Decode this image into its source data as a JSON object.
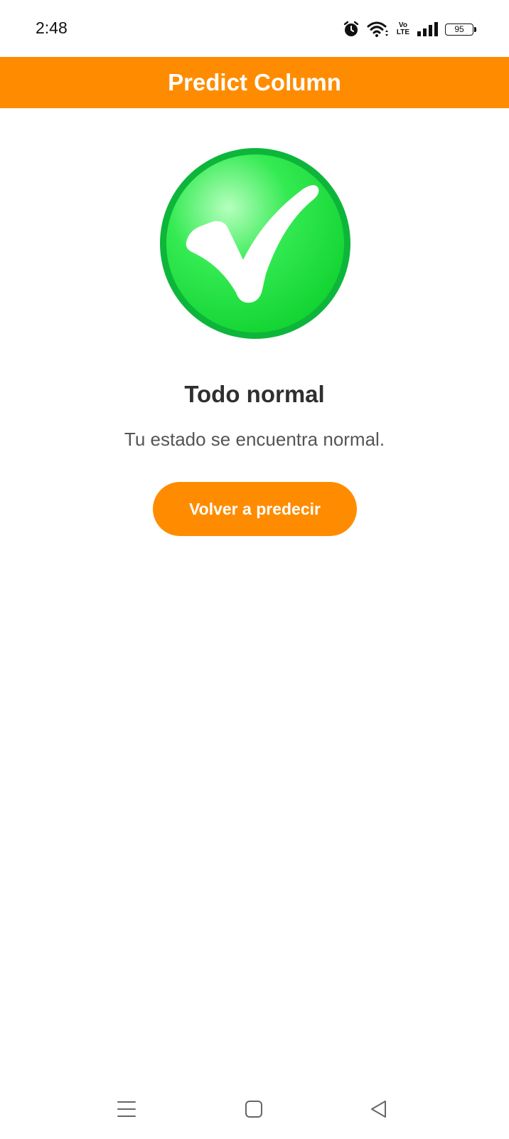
{
  "status_bar": {
    "time": "2:48",
    "icons": [
      "alarm-icon",
      "wifi-icon",
      "volte-icon",
      "signal-icon",
      "battery-icon"
    ],
    "volte_top": "Vo",
    "volte_bottom": "LTE",
    "battery_level": "95"
  },
  "app_bar": {
    "title": "Predict Column",
    "color": "#ff8c00"
  },
  "result": {
    "icon": "check-circle-icon",
    "title": "Todo normal",
    "message": "Tu estado se encuentra normal.",
    "button_label": "Volver a predecir",
    "accent_color": "#ff8c00",
    "success_color": "#1fd43c"
  },
  "nav_bar": {
    "icons": [
      "menu-icon",
      "home-icon",
      "back-icon"
    ]
  }
}
